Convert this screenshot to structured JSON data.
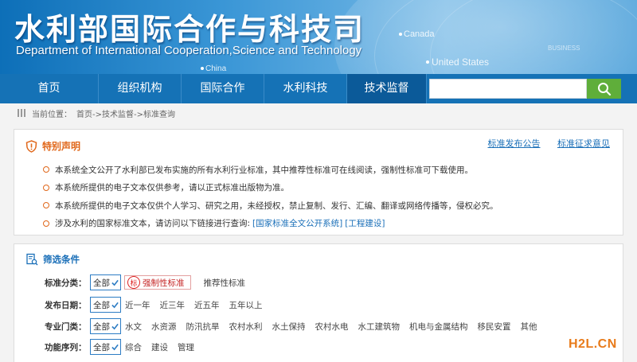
{
  "banner": {
    "title_cn": "水利部国际合作与科技司",
    "title_en": "Department of International Cooperation,Science and Technology",
    "map_labels": [
      "Canada",
      "China",
      "United  States",
      "BUSINESS"
    ]
  },
  "nav": {
    "items": [
      "首页",
      "组织机构",
      "国际合作",
      "水利科技",
      "技术监督"
    ],
    "active": "技术监督"
  },
  "search": {
    "placeholder": ""
  },
  "breadcrumb": {
    "label": "当前位置：",
    "path": "首页->技术监督->标准查询"
  },
  "notice": {
    "title": "特别声明",
    "links": [
      "标准发布公告",
      "标准征求意见"
    ],
    "items": [
      "本系统全文公开了水利部已发布实施的所有水利行业标准，其中推荐性标准可在线阅读，强制性标准可下载使用。",
      "本系统所提供的电子文本仅供参考，请以正式标准出版物为准。",
      "本系统所提供的电子文本仅供个人学习、研究之用，未经授权，禁止复制、发行、汇编、翻译或网络传播等，侵权必究。",
      "涉及水利的国家标准文本，请访问以下链接进行查询:"
    ],
    "item_links": [
      "[国家标准全文公开系统]",
      "[工程建设]"
    ]
  },
  "filter": {
    "title": "筛选条件",
    "all_label": "全部",
    "rows": [
      {
        "label": "标准分类：",
        "options": [
          "强制性标准",
          "推荐性标准"
        ],
        "seal": "标"
      },
      {
        "label": "发布日期：",
        "options": [
          "近一年",
          "近三年",
          "近五年",
          "五年以上"
        ]
      },
      {
        "label": "专业门类：",
        "options": [
          "水文",
          "水资源",
          "防汛抗旱",
          "农村水利",
          "水土保持",
          "农村水电",
          "水工建筑物",
          "机电与金属结构",
          "移民安置",
          "其他"
        ]
      },
      {
        "label": "功能序列：",
        "options": [
          "综合",
          "建设",
          "管理"
        ]
      }
    ]
  },
  "watermark": "H2L.CN",
  "colors": {
    "nav": "#1572b6",
    "nav_active": "#0b5a99",
    "accent_orange": "#e0671a",
    "link_blue": "#1a6fb8",
    "search_green": "#5fae3a"
  }
}
